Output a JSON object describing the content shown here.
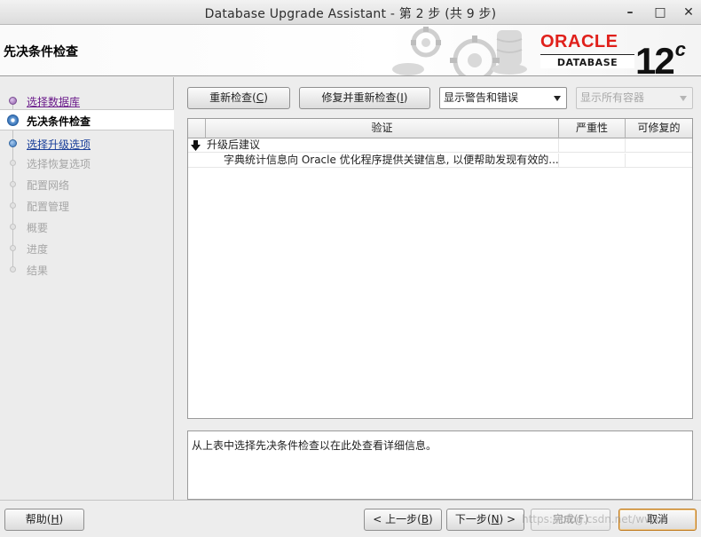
{
  "window": {
    "title": "Database Upgrade Assistant - 第 2 步 (共 9 步)",
    "controls": {
      "minimize": "–",
      "maximize": "□",
      "close": "✕"
    }
  },
  "header": {
    "step_title": "先决条件检查",
    "brand": "ORACLE",
    "brand_sub": "DATABASE",
    "version": "12",
    "version_suffix": "c",
    "brand_color": "#e0201b"
  },
  "nav": {
    "items": [
      {
        "label": "选择数据库",
        "state": "visited"
      },
      {
        "label": "先决条件检查",
        "state": "current"
      },
      {
        "label": "选择升级选项",
        "state": "link"
      },
      {
        "label": "选择恢复选项",
        "state": "disabled"
      },
      {
        "label": "配置网络",
        "state": "disabled"
      },
      {
        "label": "配置管理",
        "state": "disabled"
      },
      {
        "label": "概要",
        "state": "disabled"
      },
      {
        "label": "进度",
        "state": "disabled"
      },
      {
        "label": "结果",
        "state": "disabled"
      }
    ]
  },
  "toolbar": {
    "recheck": {
      "text": "重新检查(",
      "mnemonic": "C",
      "tail": ")"
    },
    "fix_recheck": {
      "text": "修复并重新检查(",
      "mnemonic": "I",
      "tail": ")"
    },
    "filter_selected": "显示警告和错误",
    "container_placeholder": "显示所有容器"
  },
  "table": {
    "columns": [
      "验证",
      "严重性",
      "可修复的"
    ],
    "rows": [
      {
        "text": "升级后建议",
        "type": "group",
        "severity": "",
        "fixable": ""
      },
      {
        "text": "字典统计信息向 Oracle 优化程序提供关键信息, 以便帮助发现有效的...",
        "type": "item",
        "severity": "",
        "fixable": ""
      }
    ]
  },
  "detail": {
    "text": "从上表中选择先决条件检查以在此处查看详细信息。"
  },
  "footer": {
    "help": {
      "text": "帮助(",
      "mnemonic": "H",
      "tail": ")"
    },
    "back": {
      "text": "< 上一步(",
      "mnemonic": "B",
      "tail": ")"
    },
    "next": {
      "text": "下一步(",
      "mnemonic": "N",
      "tail": ") >"
    },
    "finish": "完成(F)",
    "cancel": "取消",
    "watermark": "https://blog.csdn.net/wwxc"
  },
  "colors": {
    "accent": "#2f6eb5",
    "visited": "#6a1a8a",
    "link": "#1a3f9a"
  }
}
